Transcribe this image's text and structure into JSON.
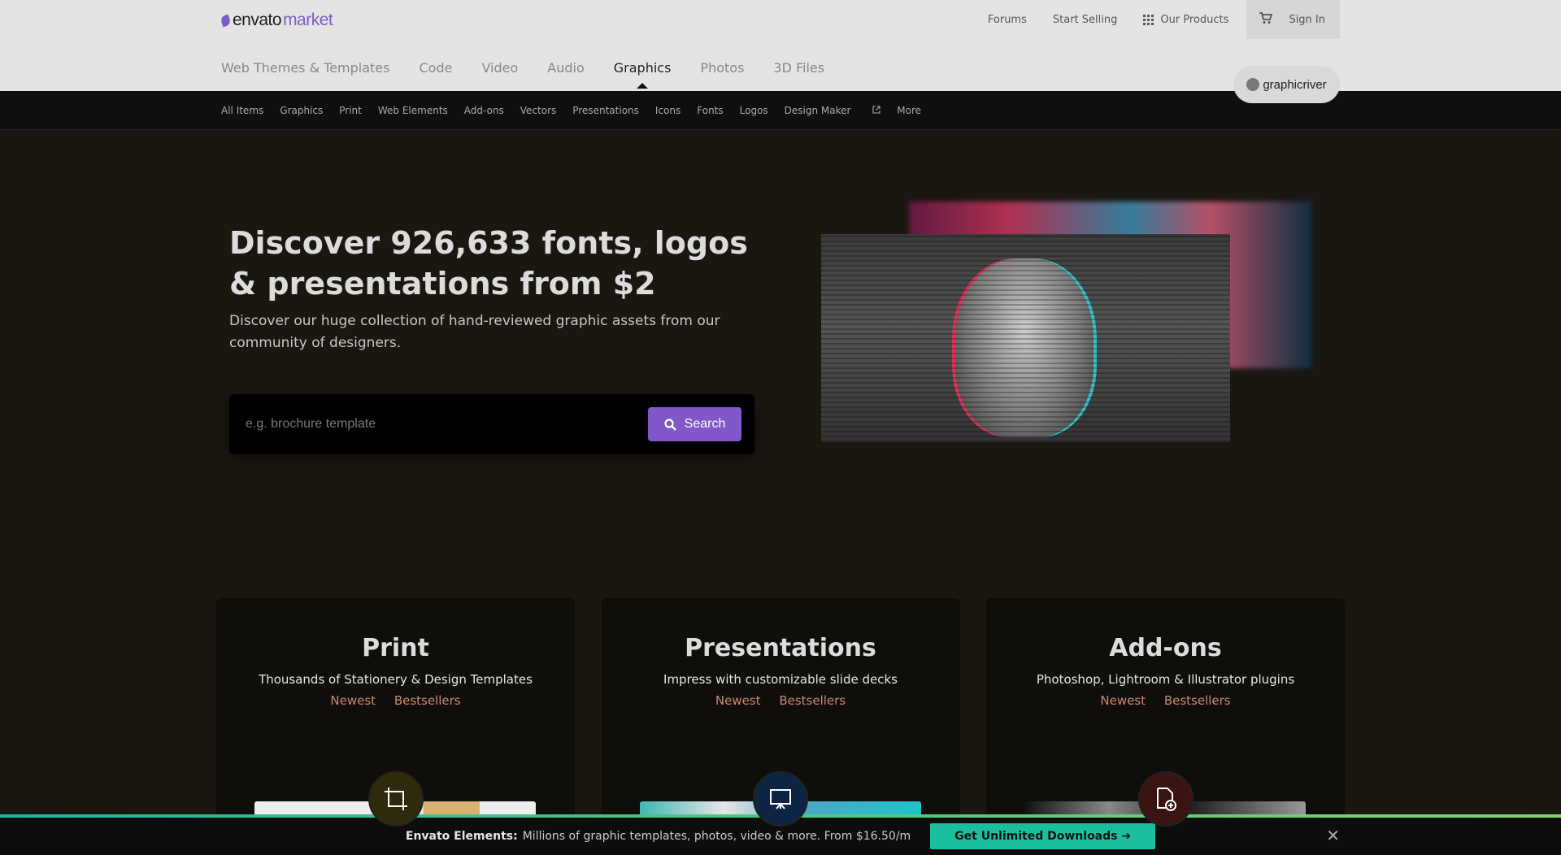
{
  "logo": {
    "envato": "envato",
    "market": "market"
  },
  "top_links": {
    "forums": "Forums",
    "start_selling": "Start Selling",
    "our_products": "Our Products",
    "sign_in": "Sign In"
  },
  "categories": [
    {
      "label": "Web Themes & Templates",
      "active": false
    },
    {
      "label": "Code",
      "active": false
    },
    {
      "label": "Video",
      "active": false
    },
    {
      "label": "Audio",
      "active": false
    },
    {
      "label": "Graphics",
      "active": true
    },
    {
      "label": "Photos",
      "active": false
    },
    {
      "label": "3D Files",
      "active": false
    }
  ],
  "brand_badge": "graphicriver",
  "subnav": [
    "All Items",
    "Graphics",
    "Print",
    "Web Elements",
    "Add-ons",
    "Vectors",
    "Presentations",
    "Icons",
    "Fonts",
    "Logos",
    "Design Maker",
    "More"
  ],
  "hero": {
    "title": "Discover 926,633 fonts, logos & presentations from $2",
    "subtitle": "Discover our huge collection of hand-reviewed graphic assets from our community of designers.",
    "search_placeholder": "e.g. brochure template",
    "search_label": "Search"
  },
  "cards": [
    {
      "title": "Print",
      "desc": "Thousands of Stationery & Design Templates",
      "newest": "Newest",
      "bestsellers": "Bestsellers",
      "icon": "crop-icon",
      "icon_bg": "#2e2a0c"
    },
    {
      "title": "Presentations",
      "desc": "Impress with customizable slide decks",
      "newest": "Newest",
      "bestsellers": "Bestsellers",
      "icon": "presentation-icon",
      "icon_bg": "#0d2444"
    },
    {
      "title": "Add-ons",
      "desc": "Photoshop, Lightroom & Illustrator plugins",
      "newest": "Newest",
      "bestsellers": "Bestsellers",
      "icon": "file-add-icon",
      "icon_bg": "#3a1410"
    }
  ],
  "banner": {
    "brand": "Envato Elements:",
    "text": "Millions of graphic templates, photos, video & more. From $16.50/m",
    "cta": "Get Unlimited Downloads ➔",
    "close": "✕"
  },
  "colors": {
    "accent": "#8257c9",
    "link_orange": "#c98a6c",
    "cta_green": "#1bbf9e"
  }
}
